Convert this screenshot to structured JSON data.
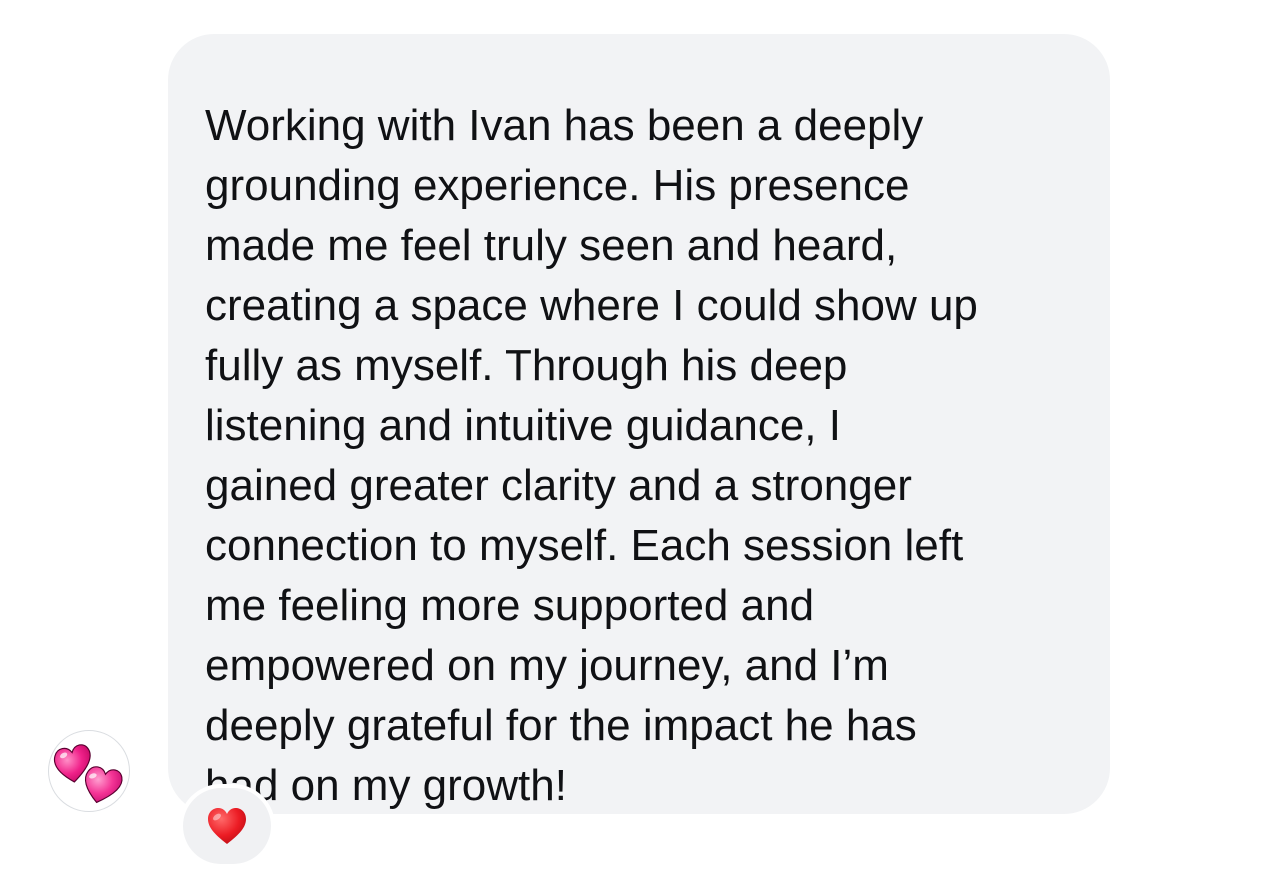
{
  "message": {
    "lines": [
      "Working with Ivan has been a deeply",
      "grounding experience. His presence",
      "made me feel truly seen and heard,",
      "creating a space where I could show up",
      "fully as myself. Through his deep",
      "listening and intuitive guidance, I",
      "gained greater clarity and a stronger",
      "connection to myself. Each session left",
      "me feeling more supported and",
      "empowered on my journey, and I’m",
      "deeply grateful for the impact he has",
      "had on my growth!"
    ]
  },
  "avatar": {
    "icon": "two-hearts-icon",
    "color": "#e8127a"
  },
  "reaction": {
    "icon": "red-heart-icon",
    "color": "#e8202a"
  },
  "colors": {
    "bubble": "#f2f3f5",
    "text": "#101114",
    "background": "#ffffff"
  }
}
